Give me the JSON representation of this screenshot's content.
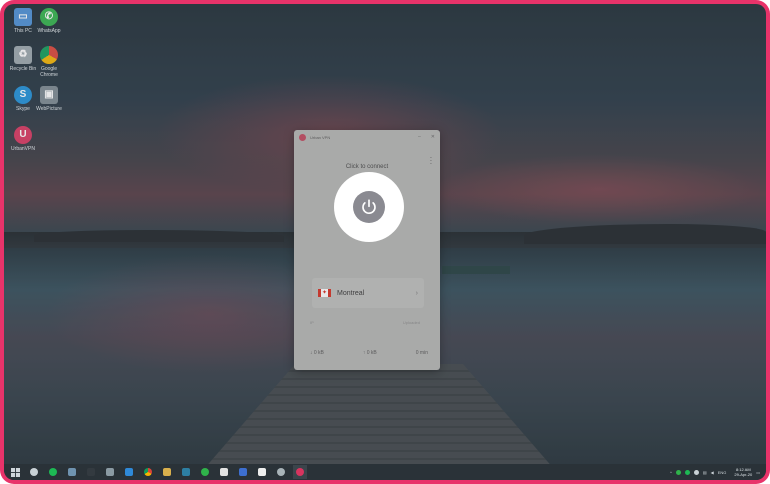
{
  "desktop": {
    "icons": [
      {
        "label": "This PC",
        "icon": "monitor-icon",
        "color": "#4a8fd6"
      },
      {
        "label": "WhatsApp",
        "icon": "whatsapp-icon",
        "color": "#2fb34a"
      },
      {
        "label": "Recycle Bin",
        "icon": "recycle-bin-icon",
        "color": "#9aa6ad"
      },
      {
        "label": "Google Chrome",
        "icon": "chrome-icon",
        "color": "#e0a823"
      },
      {
        "label": "Skype",
        "icon": "skype-icon",
        "color": "#1d8fd8"
      },
      {
        "label": "WebPicture",
        "icon": "webpicture-icon",
        "color": "#7a8890"
      },
      {
        "label": "UrbanVPN",
        "icon": "vpn-icon",
        "color": "#d8345f"
      }
    ]
  },
  "vpn_window": {
    "app_name": "Urban VPN",
    "status_text": "Click to connect",
    "location_hint": "Select location",
    "location_city": "Montreal",
    "stat_labels": [
      "IP",
      "Uploaded"
    ],
    "down_value": "↓ 0 kB",
    "up_value": "↑ 0 kB",
    "timer": "0 min",
    "flag_colors": {
      "side": "#d52b1e",
      "center": "#ffffff"
    }
  },
  "colors": {
    "frame": "#e8336a",
    "accent": "#c0455c",
    "power": "#8a8a91"
  },
  "taskbar": {
    "apps": [
      {
        "icon": "search-icon",
        "color": "#c9d1d6"
      },
      {
        "icon": "spotify-icon",
        "color": "#1db954"
      },
      {
        "icon": "file-explorer-icon",
        "color": "#6f93b0"
      },
      {
        "icon": "store-icon",
        "color": "#333a40"
      },
      {
        "icon": "calculator-icon",
        "color": "#8b9aa3"
      },
      {
        "icon": "task-icon",
        "color": "#2f89d8"
      },
      {
        "icon": "chrome-icon",
        "color": "#e0a823"
      },
      {
        "icon": "folder-icon",
        "color": "#d9b04d"
      },
      {
        "icon": "terminal-icon",
        "color": "#2d7fa3"
      },
      {
        "icon": "whatsapp-icon",
        "color": "#2fb34a"
      },
      {
        "icon": "document-icon",
        "color": "#e2e2e2"
      },
      {
        "icon": "browser-icon",
        "color": "#3d6fd1"
      },
      {
        "icon": "chat-icon",
        "color": "#eeeeee"
      },
      {
        "icon": "globe-icon",
        "color": "#a8b3b8"
      },
      {
        "icon": "vpn-icon",
        "color": "#d8345f"
      }
    ],
    "language": "ENG",
    "time": "8:12 AM",
    "date": "29-Apr-20"
  }
}
